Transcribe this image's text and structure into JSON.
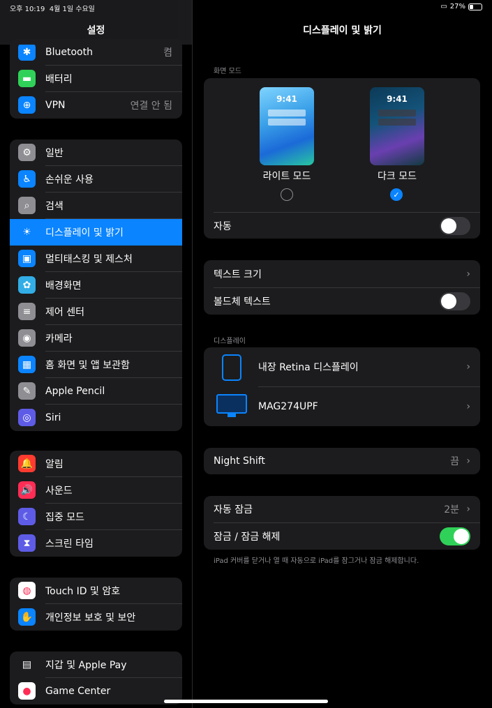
{
  "status": {
    "time": "오후 10:19",
    "date": "4월 1일 수요일",
    "battery": "27%"
  },
  "sidebar": {
    "title": "설정",
    "group1": [
      {
        "label": "Bluetooth",
        "value": "켬",
        "icon": "bluetooth-icon",
        "color": "#0a84ff",
        "glyph": "✱"
      },
      {
        "label": "배터리",
        "value": "",
        "icon": "battery-icon",
        "color": "#30d158",
        "glyph": "▬"
      },
      {
        "label": "VPN",
        "value": "연결 안 됨",
        "icon": "vpn-globe-icon",
        "color": "#0a84ff",
        "glyph": "⊕"
      }
    ],
    "group2": [
      {
        "label": "일반",
        "icon": "gear-icon",
        "color": "#8e8e93",
        "glyph": "⚙"
      },
      {
        "label": "손쉬운 사용",
        "icon": "accessibility-icon",
        "color": "#0a84ff",
        "glyph": "♿"
      },
      {
        "label": "검색",
        "icon": "search-icon",
        "color": "#8e8e93",
        "glyph": "⌕"
      },
      {
        "label": "디스플레이 및 밝기",
        "icon": "brightness-icon",
        "color": "#0a84ff",
        "glyph": "☀"
      },
      {
        "label": "멀티태스킹 및 제스처",
        "icon": "multitasking-icon",
        "color": "#0a84ff",
        "glyph": "▣"
      },
      {
        "label": "배경화면",
        "icon": "wallpaper-flower-icon",
        "color": "#32ade6",
        "glyph": "✿"
      },
      {
        "label": "제어 센터",
        "icon": "control-center-icon",
        "color": "#8e8e93",
        "glyph": "≡"
      },
      {
        "label": "카메라",
        "icon": "camera-icon",
        "color": "#8e8e93",
        "glyph": "◉"
      },
      {
        "label": "홈 화면 및 앱 보관함",
        "icon": "home-screen-icon",
        "color": "#0a84ff",
        "glyph": "▦"
      },
      {
        "label": "Apple Pencil",
        "icon": "pencil-icon",
        "color": "#8e8e93",
        "glyph": "✎"
      },
      {
        "label": "Siri",
        "icon": "siri-icon",
        "color": "#5e5ce6",
        "glyph": "◎"
      }
    ],
    "group3": [
      {
        "label": "알림",
        "icon": "bell-icon",
        "color": "#ff3b30",
        "glyph": "🔔"
      },
      {
        "label": "사운드",
        "icon": "speaker-icon",
        "color": "#ff2d55",
        "glyph": "🔊"
      },
      {
        "label": "집중 모드",
        "icon": "moon-icon",
        "color": "#5e5ce6",
        "glyph": "☾"
      },
      {
        "label": "스크린 타임",
        "icon": "hourglass-icon",
        "color": "#5e5ce6",
        "glyph": "⧗"
      }
    ],
    "group4": [
      {
        "label": "Touch ID 및 암호",
        "icon": "fingerprint-icon",
        "color": "#ffffff",
        "glyph": "◍"
      },
      {
        "label": "개인정보 보호 및 보안",
        "icon": "hand-icon",
        "color": "#0a84ff",
        "glyph": "✋"
      }
    ],
    "group5": [
      {
        "label": "지갑 및 Apple Pay",
        "icon": "wallet-icon",
        "color": "#1c1c1e",
        "glyph": "▤"
      },
      {
        "label": "Game Center",
        "icon": "game-center-icon",
        "color": "#ffffff",
        "glyph": "●"
      }
    ]
  },
  "detail": {
    "title": "디스플레이 및 밝기",
    "appearance_header": "화면 모드",
    "phone_time": "9:41",
    "light_label": "라이트 모드",
    "dark_label": "다크 모드",
    "checkmark": "✓",
    "auto_label": "자동",
    "text_size_label": "텍스트 크기",
    "bold_text_label": "볼드체 텍스트",
    "display_header": "디스플레이",
    "builtin_display_label": "내장 Retina 디스플레이",
    "external_display_label": "MAG274UPF",
    "night_shift_label": "Night Shift",
    "night_shift_value": "끔",
    "auto_lock_label": "자동 잠금",
    "auto_lock_value": "2분",
    "lock_unlock_label": "잠금 / 잠금 해제",
    "lock_footnote": "iPad 커버를 닫거나 열 때 자동으로 iPad를 잠그거나 잠금 해제합니다.",
    "chevron": "›",
    "toggles": {
      "auto": false,
      "bold_text": false,
      "lock_unlock": true
    },
    "selected_mode": "dark"
  },
  "colors": {
    "accent": "#0a84ff",
    "toggle_on": "#30d158"
  }
}
